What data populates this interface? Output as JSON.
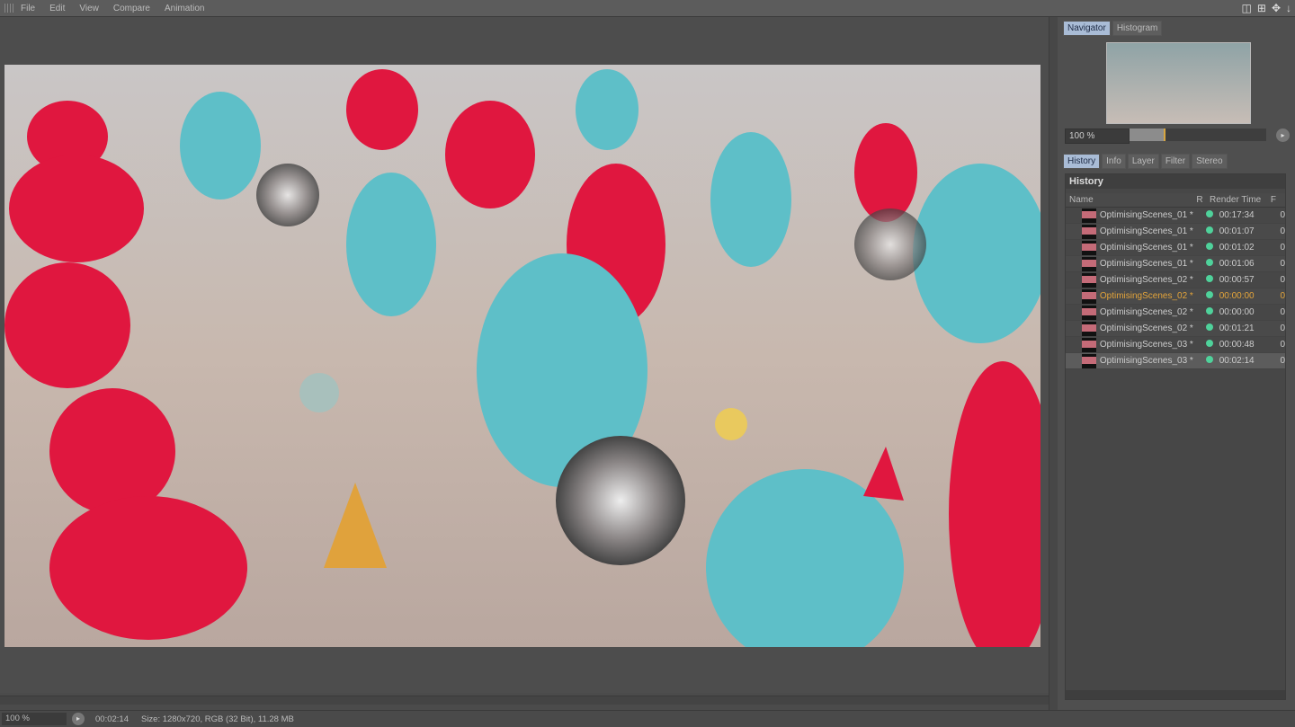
{
  "menu": [
    "File",
    "Edit",
    "View",
    "Compare",
    "Animation"
  ],
  "navigator": {
    "tabs": [
      "Navigator",
      "Histogram"
    ],
    "zoom": "100 %",
    "zoom_fraction": 0.26
  },
  "panel_tabs": [
    "History",
    "Info",
    "Layer",
    "Filter",
    "Stereo"
  ],
  "history": {
    "title": "History",
    "columns": [
      "Name",
      "R",
      "Render Time",
      "F"
    ],
    "rows": [
      {
        "name": "OptimisingScenes_01 *",
        "time": "00:17:34",
        "f": "0"
      },
      {
        "name": "OptimisingScenes_01 *",
        "time": "00:01:07",
        "f": "0"
      },
      {
        "name": "OptimisingScenes_01 *",
        "time": "00:01:02",
        "f": "0"
      },
      {
        "name": "OptimisingScenes_01 *",
        "time": "00:01:06",
        "f": "0"
      },
      {
        "name": "OptimisingScenes_02 *",
        "time": "00:00:57",
        "f": "0"
      },
      {
        "name": "OptimisingScenes_02 *",
        "time": "00:00:00",
        "f": "0"
      },
      {
        "name": "OptimisingScenes_02 *",
        "time": "00:00:00",
        "f": "0"
      },
      {
        "name": "OptimisingScenes_02 *",
        "time": "00:01:21",
        "f": "0"
      },
      {
        "name": "OptimisingScenes_03 *",
        "time": "00:00:48",
        "f": "0"
      },
      {
        "name": "OptimisingScenes_03 *",
        "time": "00:02:14",
        "f": "0"
      }
    ]
  },
  "status": {
    "zoom": "100 %",
    "time": "00:02:14",
    "info": "Size: 1280x720, RGB (32 Bit), 11.28 MB"
  },
  "colors": {
    "active_tab": "#a9bcd6",
    "current_row": "#e3a43a",
    "render_dot": "#4fd29b"
  }
}
